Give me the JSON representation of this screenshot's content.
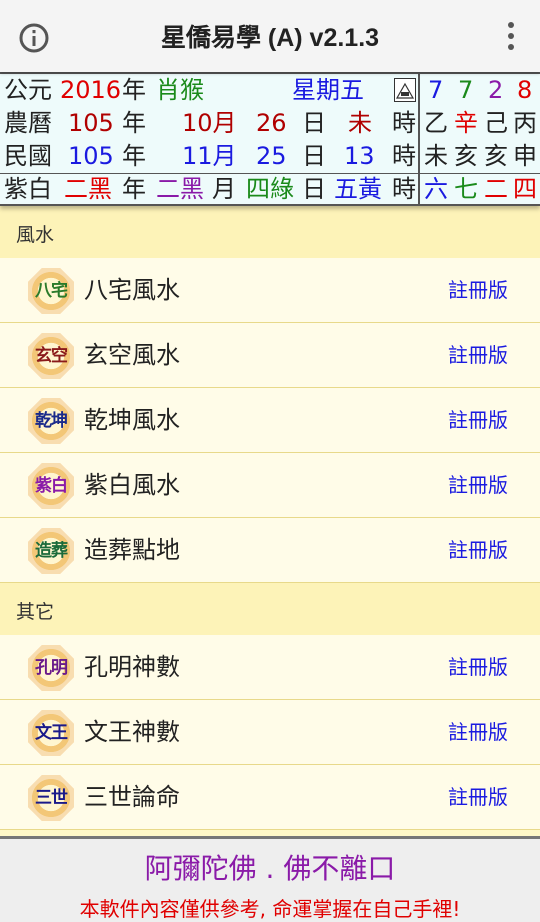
{
  "app_bar": {
    "title": "星僑易學 (A) v2.1.3",
    "info_icon": "info-circle-icon",
    "menu_icon": "more-vert-icon"
  },
  "calendar": {
    "row1": {
      "label": "公元",
      "year": "2016",
      "year_unit": "年",
      "zodiac": "肖猴",
      "weekday": "星期五",
      "nums": [
        "7",
        "7",
        "2",
        "8"
      ]
    },
    "row2": {
      "label": "農曆",
      "year": "105",
      "year_unit": "年",
      "month": "10月",
      "day": "26",
      "day_unit": "日",
      "hour": "未",
      "hour_unit": "時",
      "ganzhi": [
        "乙",
        "辛",
        "己",
        "丙"
      ]
    },
    "row3": {
      "label": "民國",
      "year": "105",
      "year_unit": "年",
      "month": "11月",
      "day": "25",
      "day_unit": "日",
      "hour": "13",
      "hour_unit": "時",
      "zhi": [
        "未",
        "亥",
        "亥",
        "申"
      ]
    },
    "row4": {
      "label": "紫白",
      "year_star": "二黑",
      "year_unit": "年",
      "month_star": "二黑",
      "month_unit": "月",
      "day_star": "四綠",
      "day_unit": "日",
      "hour_star": "五黃",
      "hour_unit": "時",
      "nums": [
        "六",
        "七",
        "二",
        "四"
      ]
    }
  },
  "sections": [
    {
      "header": "風水",
      "items": [
        {
          "badge": "八宅",
          "badge_color": "#2a7a2a",
          "label": "八宅風水",
          "action": "註冊版"
        },
        {
          "badge": "玄空",
          "badge_color": "#8a1a1a",
          "label": "玄空風水",
          "action": "註冊版"
        },
        {
          "badge": "乾坤",
          "badge_color": "#1a2a8a",
          "label": "乾坤風水",
          "action": "註冊版"
        },
        {
          "badge": "紫白",
          "badge_color": "#8a1aa8",
          "label": "紫白風水",
          "action": "註冊版"
        },
        {
          "badge": "造葬",
          "badge_color": "#1a6a3a",
          "label": "造葬點地",
          "action": "註冊版"
        }
      ]
    },
    {
      "header": "其它",
      "items": [
        {
          "badge": "孔明",
          "badge_color": "#6a1a8a",
          "label": "孔明神數",
          "action": "註冊版"
        },
        {
          "badge": "文王",
          "badge_color": "#1a1a8a",
          "label": "文王神數",
          "action": "註冊版"
        },
        {
          "badge": "三世",
          "badge_color": "#1a1a8a",
          "label": "三世論命",
          "action": "註冊版"
        }
      ]
    }
  ],
  "footer": {
    "line1": "阿彌陀佛 . 佛不離口",
    "line2": "本軟件內容僅供參考, 命運掌握在自己手裡!"
  }
}
